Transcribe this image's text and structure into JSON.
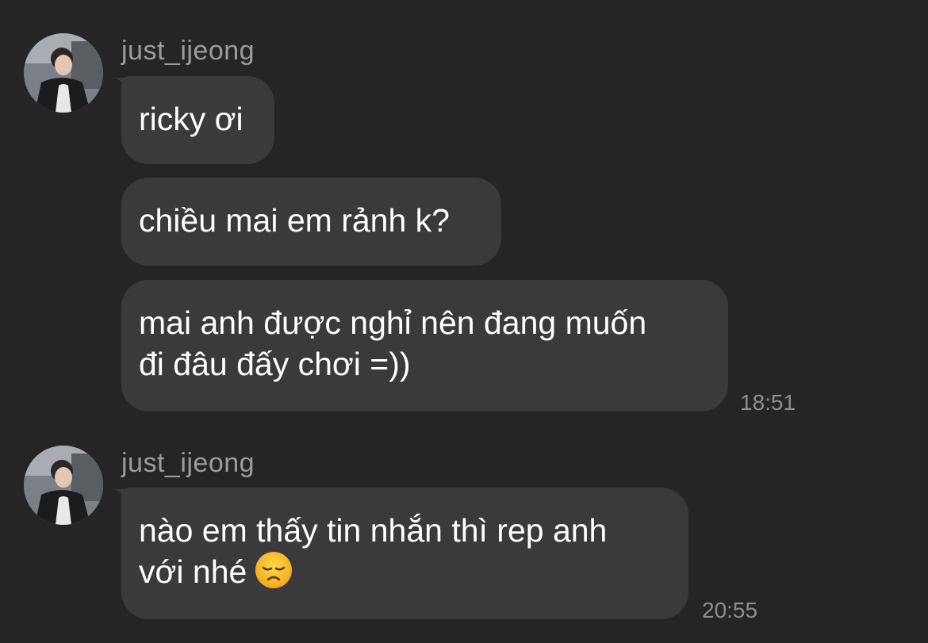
{
  "groups": [
    {
      "sender": "just_ijeong",
      "avatar_icon": "user-photo-icon",
      "messages": [
        {
          "lines": [
            "ricky ơi"
          ]
        },
        {
          "lines": [
            "chiều mai em rảnh k?"
          ]
        },
        {
          "lines": [
            "mai anh được nghỉ nên đang muốn",
            "đi đâu đấy chơi =))"
          ]
        }
      ],
      "time": "18:51"
    },
    {
      "sender": "just_ijeong",
      "avatar_icon": "user-photo-icon",
      "messages": [
        {
          "lines": [
            "nào em thấy tin nhắn thì rep anh",
            "với nhé"
          ],
          "emoji": "disappointed-face-icon"
        }
      ],
      "time": "20:55"
    }
  ],
  "colors": {
    "background": "#252527",
    "bubble": "#3a3a3c",
    "text": "#ffffff",
    "meta_text": "#9c9ca0"
  }
}
